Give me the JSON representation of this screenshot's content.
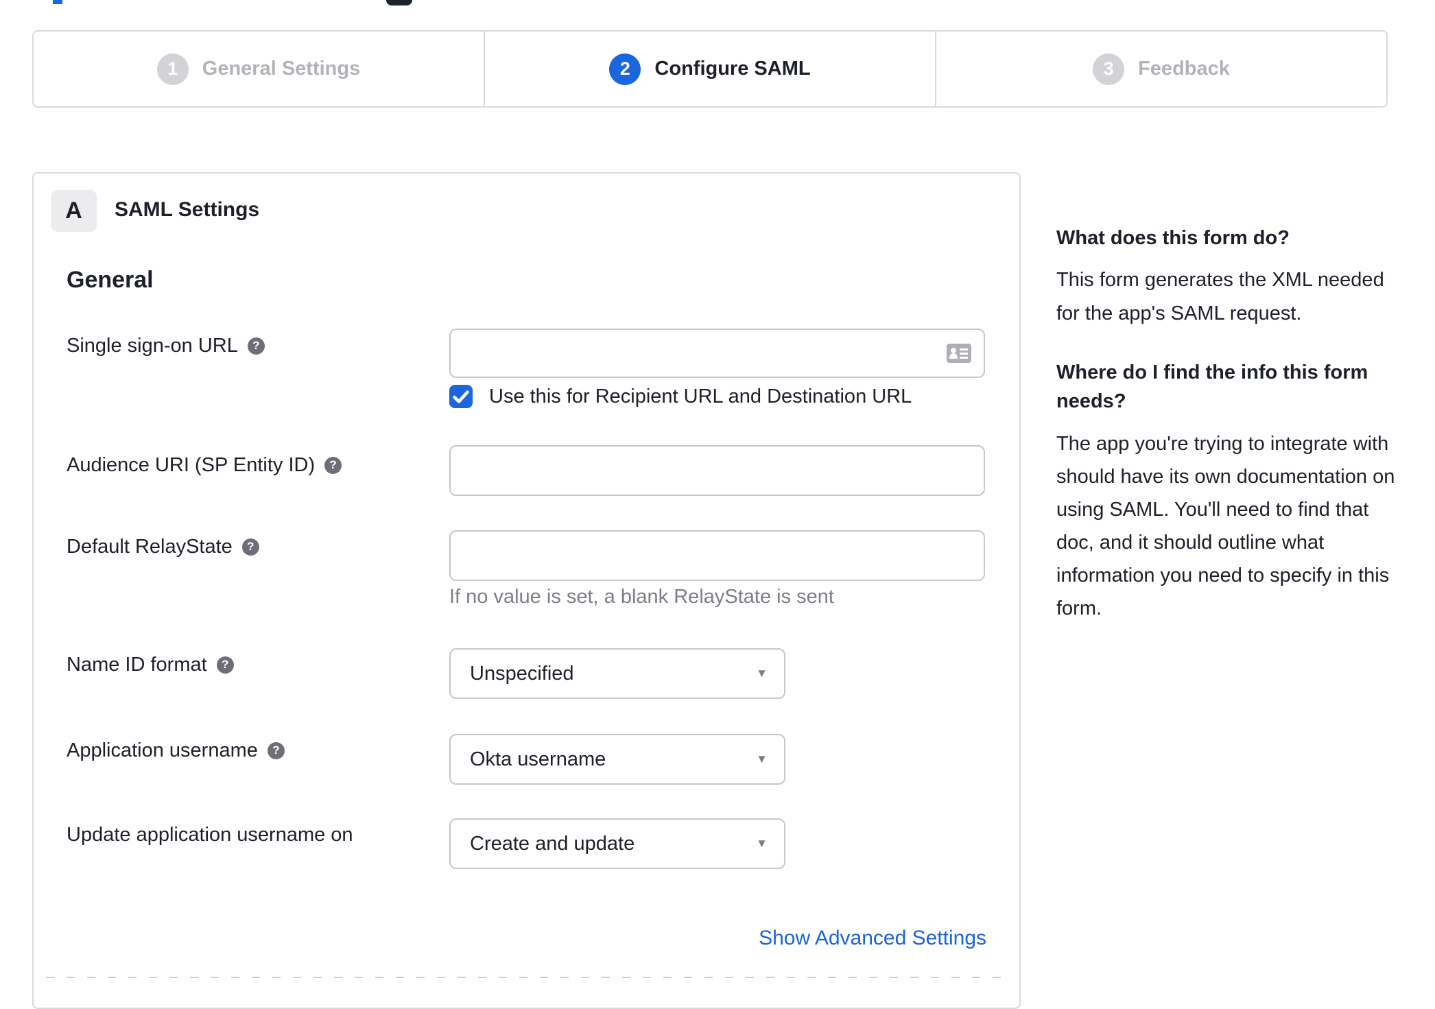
{
  "colors": {
    "accent_blue": "#1b66dd",
    "link_blue": "#1b63dd"
  },
  "stepper": {
    "steps": [
      {
        "number": "1",
        "label": "General Settings",
        "state": "inactive"
      },
      {
        "number": "2",
        "label": "Configure SAML",
        "state": "active"
      },
      {
        "number": "3",
        "label": "Feedback",
        "state": "inactive"
      }
    ]
  },
  "panel": {
    "section_letter": "A",
    "section_title": "SAML Settings",
    "group_heading": "General",
    "fields": {
      "sso": {
        "label": "Single sign-on URL",
        "value": "",
        "checkbox_label": "Use this for Recipient URL and Destination URL",
        "checkbox_checked": true
      },
      "audience": {
        "label": "Audience URI (SP Entity ID)",
        "value": ""
      },
      "relay": {
        "label": "Default RelayState",
        "value": "",
        "hint": "If no value is set, a blank RelayState is sent"
      },
      "nameid": {
        "label": "Name ID format",
        "value": "Unspecified"
      },
      "appuser": {
        "label": "Application username",
        "value": "Okta username"
      },
      "updateuser": {
        "label": "Update application username on",
        "value": "Create and update"
      }
    },
    "advanced_link": "Show Advanced Settings"
  },
  "sidebar": {
    "q1": "What does this form do?",
    "a1": "This form generates the XML needed for the app's SAML request.",
    "q2": "Where do I find the info this form needs?",
    "a2": "The app you're trying to integrate with should have its own documentation on using SAML. You'll need to find that doc, and it should outline what information you need to specify in this form."
  }
}
